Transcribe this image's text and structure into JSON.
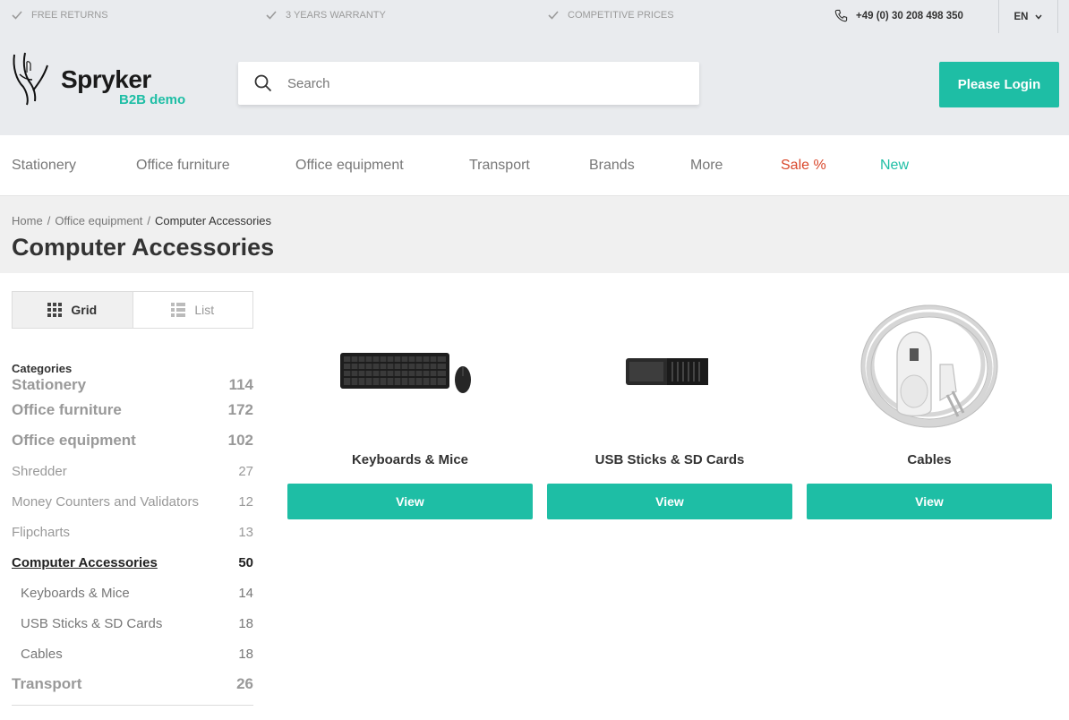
{
  "topbar": {
    "usp": [
      "Free returns",
      "3 years warranty",
      "Competitive prices"
    ],
    "phone": "+49 (0) 30 208 498 350",
    "lang": "EN"
  },
  "header": {
    "logo_word": "Spryker",
    "logo_sub": "B2B demo",
    "search_placeholder": "Search",
    "login_label": "Please Login"
  },
  "nav": {
    "items": [
      "Stationery",
      "Office furniture",
      "Office equipment",
      "Transport",
      "Brands",
      "More"
    ],
    "sale": "Sale %",
    "new": "New",
    "sale_color": "#d9472b",
    "new_color": "#1ebea5"
  },
  "breadcrumb": [
    "Home",
    "Office equipment",
    "Computer Accessories"
  ],
  "page_title": "Computer Accessories",
  "view_toggle": {
    "grid": "Grid",
    "list": "List"
  },
  "categories": {
    "heading": "Categories",
    "items": [
      {
        "name": "Stationery",
        "count": "114"
      },
      {
        "name": "Office furniture",
        "count": "172"
      },
      {
        "name": "Office equipment",
        "count": "102"
      },
      {
        "name": "Shredder",
        "count": "27"
      },
      {
        "name": "Money Counters and Validators",
        "count": "12"
      },
      {
        "name": "Flipcharts",
        "count": "13"
      },
      {
        "name": "Computer Accessories",
        "count": "50"
      },
      {
        "name": "Keyboards & Mice",
        "count": "14"
      },
      {
        "name": "USB Sticks & SD Cards",
        "count": "18"
      },
      {
        "name": "Cables",
        "count": "18"
      },
      {
        "name": "Transport",
        "count": "26"
      }
    ]
  },
  "products": [
    {
      "name": "Keyboards & Mice",
      "button": "View"
    },
    {
      "name": "USB Sticks & SD Cards",
      "button": "View"
    },
    {
      "name": "Cables",
      "button": "View"
    }
  ],
  "colors": {
    "accent": "#1ebea5"
  }
}
